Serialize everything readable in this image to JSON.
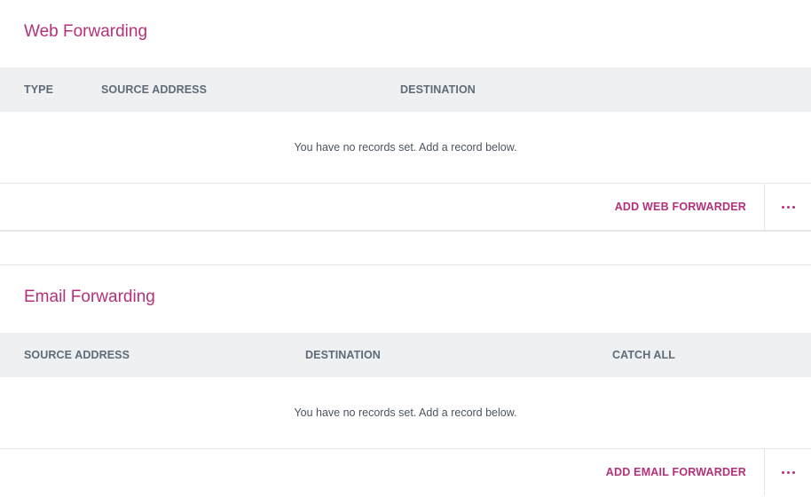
{
  "web_forwarding": {
    "title": "Web Forwarding",
    "columns": [
      "TYPE",
      "SOURCE ADDRESS",
      "DESTINATION"
    ],
    "empty_message": "You have no records set. Add a record below.",
    "add_button_label": "ADD WEB FORWARDER"
  },
  "email_forwarding": {
    "title": "Email Forwarding",
    "columns": [
      "SOURCE ADDRESS",
      "DESTINATION",
      "CATCH ALL"
    ],
    "empty_message": "You have no records set. Add a record below.",
    "add_button_label": "ADD EMAIL FORWARDER"
  },
  "colors": {
    "accent": "#b5307a",
    "header_bg": "#eff0f1",
    "border": "#e4e6e8"
  }
}
